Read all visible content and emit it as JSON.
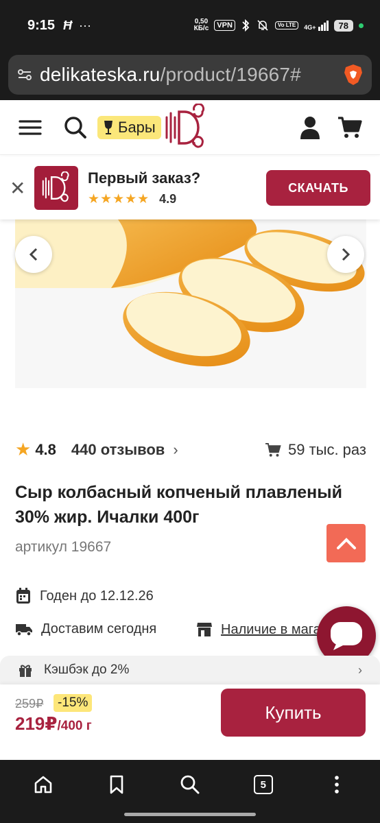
{
  "status_bar": {
    "time": "9:15",
    "net_speed_value": "0,50",
    "net_speed_unit": "КБ/с",
    "vpn": "VPN",
    "volte": "Vo LTE",
    "signal": "4G+",
    "battery": "78"
  },
  "browser": {
    "url_host": "delikateska.ru",
    "url_path": "/product/19667#"
  },
  "header": {
    "category_badge": "Бары",
    "icons": [
      "menu-icon",
      "search-icon",
      "user-icon",
      "cart-icon"
    ]
  },
  "app_banner": {
    "title": "Первый заказ?",
    "stars": "★★★★★",
    "rating": "4.9",
    "download_label": "СКАЧАТЬ"
  },
  "gallery": {
    "slide_count": 4,
    "active_slide": 1
  },
  "product": {
    "rating": "4.8",
    "reviews": "440 отзывов",
    "sold": "59 тыс. раз",
    "title": "Сыр колбасный копченый плавленый 30% жир. Ичалки 400г",
    "article": "артикул 19667",
    "expiry": "Годен до 12.12.26",
    "delivery": "Доставим сегодня",
    "stock_link": "Наличие в магазинах",
    "cashback": "Кэшбэк до 2%"
  },
  "buy": {
    "old_price": "259₽",
    "discount": "-15%",
    "price": "219₽",
    "price_unit": "/400 г",
    "buy_label": "Купить"
  },
  "bottom_nav": {
    "tab_count": "5"
  },
  "colors": {
    "brand": "#a8223f",
    "accent_star": "#f5a623",
    "scroll_top": "#f26a56"
  }
}
